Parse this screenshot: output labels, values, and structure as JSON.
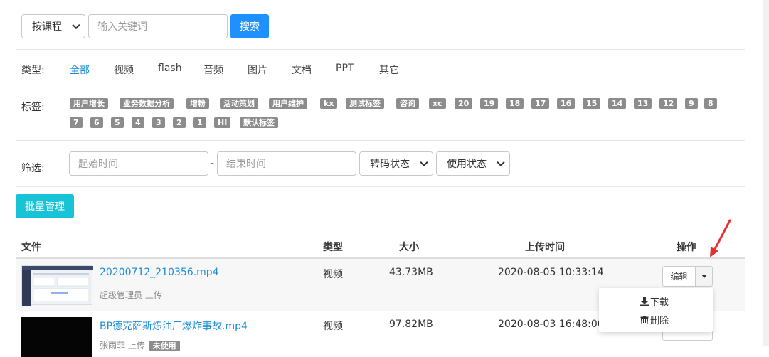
{
  "search": {
    "mode_select": "按课程",
    "keyword_placeholder": "输入关键词",
    "search_label": "搜索"
  },
  "types": {
    "label": "类型:",
    "items": [
      "全部",
      "视频",
      "flash",
      "音频",
      "图片",
      "文档",
      "PPT",
      "其它"
    ]
  },
  "tags": {
    "label": "标签:",
    "row1": [
      "用户增长",
      "业务数据分析",
      "增粉",
      "活动策划",
      "用户维护",
      "kx",
      "测试标签",
      "咨询",
      "xc",
      "20",
      "19",
      "18",
      "17",
      "16",
      "15",
      "14",
      "13",
      "12",
      "9",
      "8"
    ],
    "row2": [
      "7",
      "6",
      "5",
      "4",
      "3",
      "2",
      "1",
      "HI",
      "默认标签"
    ]
  },
  "filter": {
    "label": "筛选:",
    "start_placeholder": "起始时间",
    "dash": "-",
    "end_placeholder": "结束时间",
    "transcode_select": "转码状态",
    "usage_select": "使用状态"
  },
  "batch_label": "批量管理",
  "table": {
    "headers": {
      "file": "文件",
      "type": "类型",
      "size": "大小",
      "time": "上传时间",
      "ops": "操作"
    },
    "rows": [
      {
        "name": "20200712_210356.mp4",
        "uploader": "超级管理员 上传",
        "type": "视频",
        "size": "43.73MB",
        "time": "2020-08-05 10:33:14"
      },
      {
        "name": "BP德克萨斯炼油厂爆炸事故.mp4",
        "uploader": "张雨菲 上传",
        "badge": "未使用",
        "type": "视频",
        "size": "97.82MB",
        "time": "2020-08-03 16:48:00"
      }
    ],
    "edit_label": "编辑",
    "dropdown": {
      "download": "下载",
      "delete": "删除"
    }
  },
  "colors": {
    "primary": "#1e90ff",
    "cyan": "#17c3d6",
    "link": "#1e8fd4",
    "tag_bg": "#8c8c8c",
    "arrow": "#e53030"
  }
}
